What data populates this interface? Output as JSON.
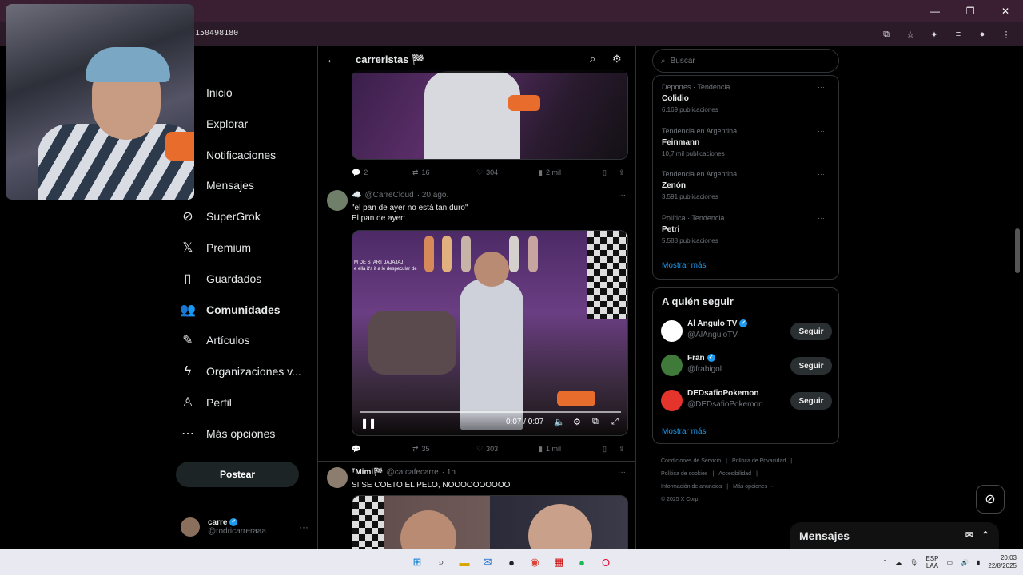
{
  "browser": {
    "url_fragment": "150498180",
    "window_controls": [
      "minimize-icon",
      "restore-icon",
      "close-icon"
    ],
    "addr_icons": [
      "cast-icon",
      "star-icon",
      "extensions-icon",
      "media-icon",
      "profile-avatar",
      "menu-icon"
    ]
  },
  "sidebar": {
    "items": [
      {
        "icon": "home-icon",
        "label": "Inicio"
      },
      {
        "icon": "explore-icon",
        "label": "Explorar"
      },
      {
        "icon": "bell-icon",
        "label": "Notificaciones"
      },
      {
        "icon": "mail-icon",
        "label": "Mensajes"
      },
      {
        "icon": "grok-icon",
        "label": "SuperGrok"
      },
      {
        "icon": "x-logo-icon",
        "label": "Premium"
      },
      {
        "icon": "bookmark-icon",
        "label": "Guardados"
      },
      {
        "icon": "communities-icon",
        "label": "Comunidades"
      },
      {
        "icon": "article-icon",
        "label": "Artículos"
      },
      {
        "icon": "lightning-icon",
        "label": "Organizaciones v..."
      },
      {
        "icon": "profile-icon",
        "label": "Perfil"
      },
      {
        "icon": "more-circle-icon",
        "label": "Más opciones"
      }
    ],
    "post_label": "Postear",
    "account": {
      "name": "carre",
      "handle": "@rodricarreraaa",
      "more": "···"
    }
  },
  "feed": {
    "title": "carreristas 🏁",
    "tweet1_actions": {
      "replies": "2",
      "reposts": "16",
      "likes": "304",
      "views": "2 mil"
    },
    "tweet2": {
      "author": "☁️",
      "handle": "@CarreCloud",
      "time": "· 20 ago.",
      "text1": "\"el pan de ayer no está tan duro\"",
      "text2": "El pan de ayer:",
      "overlay1": "M DE START JAJAJAJ",
      "overlay2": "e ella it's it a le despecular de",
      "video_time": "0:07 / 0:07",
      "actions": {
        "replies": "",
        "reposts": "35",
        "likes": "303",
        "views": "1 mil"
      }
    },
    "tweet3": {
      "author": "ᵀMimi🏁",
      "handle": "@catcafecarre",
      "time": "· 1h",
      "text": "SI SE COETO EL PELO, NOOOOOOOOOO"
    }
  },
  "right": {
    "search_placeholder": "Buscar",
    "trends": [
      {
        "category": "Deportes · Tendencia",
        "name": "Colidio",
        "count": "6.169 publicaciones"
      },
      {
        "category": "Tendencia en Argentina",
        "name": "Feinmann",
        "count": "10,7 mil publicaciones"
      },
      {
        "category": "Tendencia en Argentina",
        "name": "Zenón",
        "count": "3.591 publicaciones"
      },
      {
        "category": "Política · Tendencia",
        "name": "Petri",
        "count": "5.588 publicaciones"
      }
    ],
    "show_more": "Mostrar más",
    "follow_title": "A quién seguir",
    "follow": [
      {
        "name": "Al Angulo TV",
        "handle": "@AlAnguloTV",
        "btn": "Seguir",
        "color": "#ffffff"
      },
      {
        "name": "Fran",
        "handle": "@frabigol",
        "btn": "Seguir",
        "color": "#3f7a3a"
      },
      {
        "name": "DEDsafioPokemon",
        "handle": "@DEDsafioPokemon",
        "btn": "Seguir",
        "color": "#e4342b"
      }
    ],
    "follow_more": "Mostrar más",
    "footer": [
      "Condiciones de Servicio",
      "|",
      "Política de Privacidad",
      "|",
      "Política de cookies",
      "|",
      "Accesibilidad",
      "|",
      "Información de anuncios",
      "|",
      "Más opciones ···",
      "© 2025 X Corp."
    ]
  },
  "messages": {
    "label": "Mensajes"
  },
  "taskbar": {
    "lang1": "ESP",
    "lang2": "LAA",
    "time": "20:03",
    "date": "22/8/2025"
  },
  "colors": {
    "accent": "#1d9bf0",
    "chrome": "#3a1f33",
    "bg": "#000000"
  }
}
